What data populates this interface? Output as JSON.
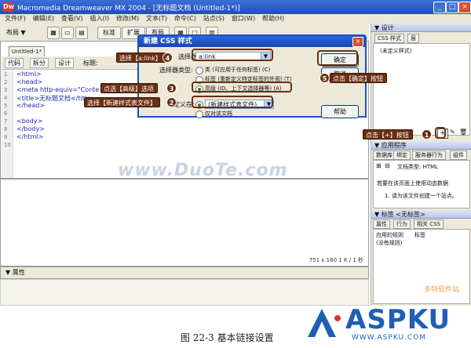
{
  "window": {
    "title": "Macromedia Dreamweaver MX 2004 - [无标题文档 (Untitled-1*)]",
    "minimize": "_",
    "maximize": "□",
    "close": "×"
  },
  "menu": [
    "文件(F)",
    "编辑(E)",
    "查看(V)",
    "插入(I)",
    "修改(M)",
    "文本(T)",
    "命令(C)",
    "站点(S)",
    "窗口(W)",
    "帮助(H)"
  ],
  "toolbar": {
    "layout_label": "布局 ▼",
    "buttons": [
      "标准",
      "扩展",
      "布局"
    ]
  },
  "document": {
    "tab_label": "Untitled-1*",
    "view_buttons": [
      "代码",
      "拆分",
      "设计"
    ],
    "title_label": "标题:",
    "line_numbers": [
      "1",
      "2",
      "3",
      "4",
      "5",
      "6",
      "7",
      "8",
      "9",
      "10"
    ],
    "code_lines": [
      "<html>",
      "<head>",
      "<meta http-equiv=\"Conte",
      "<title>无标题文档</title>",
      "</head>",
      "",
      "<body>",
      "</body>",
      "</html>",
      ""
    ],
    "status": "751 x 160   1 K / 1 秒"
  },
  "properties_panel": {
    "title": "▼ 属性"
  },
  "right_panels": {
    "design": {
      "title": "▼ 设计",
      "tabs": [
        "CSS 样式",
        "层"
      ],
      "item": "(未定义样式)"
    },
    "application": {
      "title": "▼ 应用程序",
      "tabs": [
        "数据库",
        "绑定",
        "服务器行为",
        "组件"
      ],
      "doc_type": "文档类型: HTML",
      "hint1": "若要在该页面上使用动态数据",
      "hint2": "1. 请为该文件创建一个站点。"
    },
    "tag": {
      "title": "▼ 标签 <无标签>",
      "tabs": [
        "属性",
        "行为",
        "相关 CSS"
      ],
      "row_headers": [
        "应用的规则",
        "标签"
      ],
      "row_value": "(没有规则)"
    }
  },
  "dialog": {
    "title": "新建 CSS 样式",
    "close": "×",
    "selector_label": "选择器:",
    "selector_value": "a:link",
    "selector_type_label": "选择器类型:",
    "radio_options": [
      "类 (可应用于任何标签) (C)",
      "标签 (重新定义特定标签的外观) (T)",
      "高级 (ID、上下文选择器等) (A)"
    ],
    "define_label": "定义在:",
    "define_value": "(新建样式表文件)",
    "define_option2": "仅对该文档",
    "ok": "确定",
    "cancel": "取消",
    "help": "帮助"
  },
  "callouts": {
    "c1": "点击【+】按钮",
    "c2": "选择【新建样式表文件】",
    "c3": "点选【高级】选项",
    "c4": "选择【a:link】",
    "c5": "点击【确定】按钮",
    "numbers": [
      "1",
      "2",
      "3",
      "4",
      "5"
    ]
  },
  "watermark": "www.DuoTe.com",
  "caption": "图 22-3   基本链接设置",
  "logo": {
    "text": "ASPKU",
    "url": "WWW.ASPKU.COM",
    "corner": "多特软件站"
  },
  "colors": {
    "callout": "#6b2e10",
    "titlebar": "#1f4fb8",
    "logo": "#1f5fb5"
  }
}
